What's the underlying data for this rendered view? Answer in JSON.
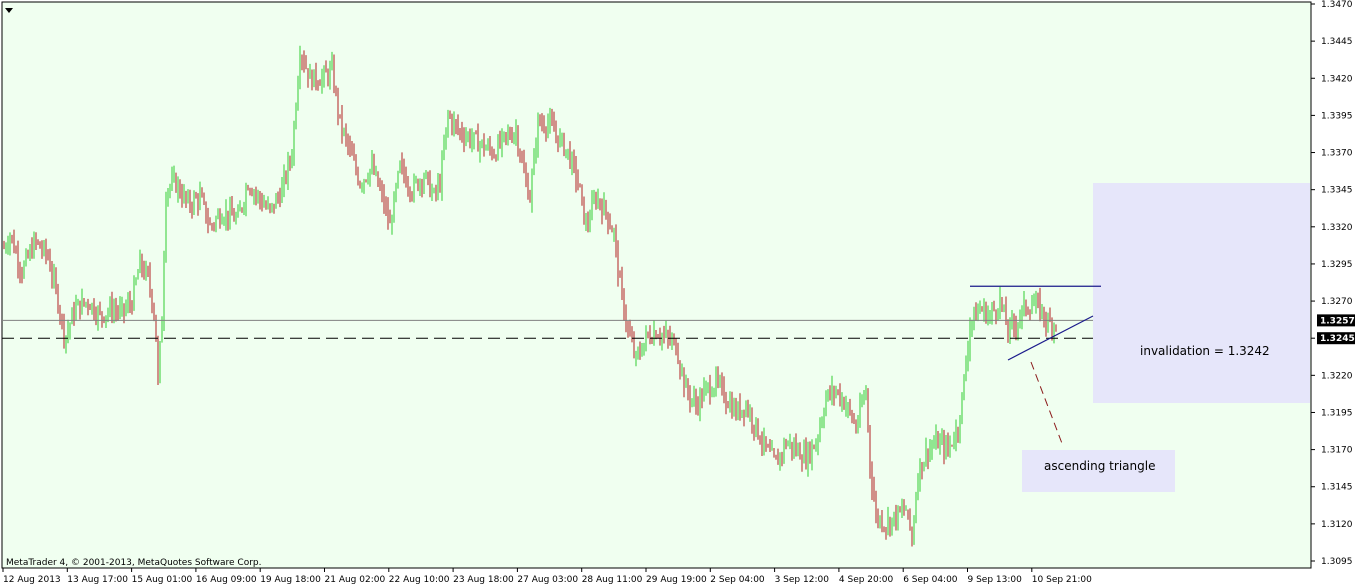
{
  "app": {
    "copyright": "MetaTrader 4, © 2001-2013, MetaQuotes Software Corp."
  },
  "chart_data": {
    "type": "candlestick",
    "y_ticks": [
      "1.3470",
      "1.3445",
      "1.3420",
      "1.3395",
      "1.3370",
      "1.3345",
      "1.3320",
      "1.3295",
      "1.3270",
      "1.3245",
      "1.3220",
      "1.3195",
      "1.3170",
      "1.3145",
      "1.3120",
      "1.3095"
    ],
    "ylim": [
      1.3095,
      1.347
    ],
    "x_tick_labels": [
      "12 Aug 2013",
      "13 Aug 17:00",
      "15 Aug 01:00",
      "16 Aug 09:00",
      "19 Aug 18:00",
      "21 Aug 02:00",
      "22 Aug 10:00",
      "23 Aug 18:00",
      "27 Aug 03:00",
      "28 Aug 11:00",
      "29 Aug 19:00",
      "2 Sep 04:00",
      "3 Sep 12:00",
      "4 Sep 20:00",
      "6 Sep 04:00",
      "9 Sep 13:00",
      "10 Sep 21:00"
    ],
    "colors": {
      "bull": "#32cd32",
      "bear": "#b22222",
      "grid": "#000000",
      "background": "#f0fff0",
      "annotation_box": "#e6e6fa"
    },
    "price_path": [
      [
        0,
        1.33
      ],
      [
        10,
        1.3315
      ],
      [
        22,
        1.329
      ],
      [
        35,
        1.331
      ],
      [
        48,
        1.33
      ],
      [
        58,
        1.327
      ],
      [
        65,
        1.3245
      ],
      [
        75,
        1.3265
      ],
      [
        88,
        1.327
      ],
      [
        100,
        1.326
      ],
      [
        112,
        1.3265
      ],
      [
        122,
        1.3262
      ],
      [
        132,
        1.327
      ],
      [
        140,
        1.3295
      ],
      [
        148,
        1.3285
      ],
      [
        155,
        1.326
      ],
      [
        158,
        1.3215
      ],
      [
        162,
        1.326
      ],
      [
        166,
        1.3345
      ],
      [
        175,
        1.335
      ],
      [
        188,
        1.3335
      ],
      [
        200,
        1.334
      ],
      [
        210,
        1.332
      ],
      [
        222,
        1.333
      ],
      [
        238,
        1.3325
      ],
      [
        248,
        1.335
      ],
      [
        258,
        1.334
      ],
      [
        270,
        1.333
      ],
      [
        282,
        1.3345
      ],
      [
        292,
        1.337
      ],
      [
        300,
        1.344
      ],
      [
        310,
        1.342
      ],
      [
        322,
        1.342
      ],
      [
        332,
        1.3425
      ],
      [
        340,
        1.339
      ],
      [
        350,
        1.337
      ],
      [
        360,
        1.335
      ],
      [
        372,
        1.336
      ],
      [
        382,
        1.334
      ],
      [
        390,
        1.332
      ],
      [
        400,
        1.336
      ],
      [
        412,
        1.3345
      ],
      [
        424,
        1.3355
      ],
      [
        434,
        1.334
      ],
      [
        440,
        1.335
      ],
      [
        448,
        1.3395
      ],
      [
        458,
        1.3385
      ],
      [
        470,
        1.338
      ],
      [
        482,
        1.3375
      ],
      [
        494,
        1.337
      ],
      [
        506,
        1.338
      ],
      [
        516,
        1.3385
      ],
      [
        524,
        1.3355
      ],
      [
        530,
        1.334
      ],
      [
        538,
        1.339
      ],
      [
        548,
        1.339
      ],
      [
        558,
        1.338
      ],
      [
        568,
        1.337
      ],
      [
        578,
        1.335
      ],
      [
        586,
        1.332
      ],
      [
        596,
        1.334
      ],
      [
        606,
        1.333
      ],
      [
        614,
        1.3315
      ],
      [
        620,
        1.328
      ],
      [
        628,
        1.325
      ],
      [
        636,
        1.323
      ],
      [
        646,
        1.3245
      ],
      [
        656,
        1.325
      ],
      [
        666,
        1.3245
      ],
      [
        676,
        1.324
      ],
      [
        686,
        1.321
      ],
      [
        696,
        1.32
      ],
      [
        706,
        1.321
      ],
      [
        716,
        1.3215
      ],
      [
        726,
        1.3205
      ],
      [
        736,
        1.3195
      ],
      [
        746,
        1.32
      ],
      [
        756,
        1.3185
      ],
      [
        766,
        1.317
      ],
      [
        776,
        1.316
      ],
      [
        786,
        1.3175
      ],
      [
        796,
        1.317
      ],
      [
        806,
        1.3165
      ],
      [
        816,
        1.3175
      ],
      [
        826,
        1.3205
      ],
      [
        836,
        1.321
      ],
      [
        846,
        1.32
      ],
      [
        856,
        1.3185
      ],
      [
        866,
        1.321
      ],
      [
        870,
        1.316
      ],
      [
        876,
        1.3125
      ],
      [
        886,
        1.312
      ],
      [
        896,
        1.3125
      ],
      [
        906,
        1.313
      ],
      [
        912,
        1.311
      ],
      [
        918,
        1.3155
      ],
      [
        928,
        1.317
      ],
      [
        938,
        1.3175
      ],
      [
        948,
        1.317
      ],
      [
        958,
        1.3185
      ],
      [
        964,
        1.3215
      ],
      [
        970,
        1.3255
      ],
      [
        980,
        1.3265
      ],
      [
        990,
        1.326
      ],
      [
        1000,
        1.327
      ],
      [
        1008,
        1.325
      ],
      [
        1016,
        1.3255
      ],
      [
        1024,
        1.3265
      ],
      [
        1032,
        1.3268
      ],
      [
        1040,
        1.3265
      ],
      [
        1048,
        1.3255
      ],
      [
        1056,
        1.3255
      ]
    ],
    "current_price_line": 1.3257,
    "invalidation_line": 1.3245,
    "current_price_label": "1.3257",
    "invalidation_price_label": "1.3245",
    "resistance_price": 1.328,
    "annotations": {
      "invalidation": "invalidation = 1.3242",
      "pattern": "ascending triangle"
    }
  }
}
